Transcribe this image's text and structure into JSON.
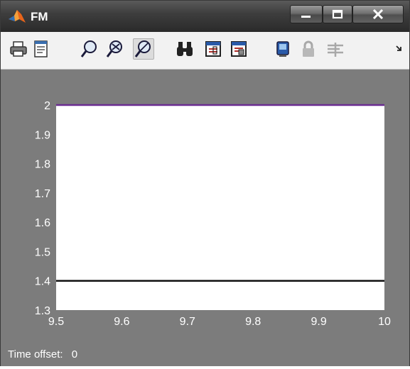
{
  "window": {
    "title": "FM",
    "buttons": [
      "minimize",
      "maximize",
      "close"
    ]
  },
  "toolbar": {
    "icons": [
      "print-icon",
      "print-preview-icon",
      "zoom-in-icon",
      "zoom-x-icon",
      "zoom-y-icon",
      "find-icon",
      "scope-parameters-icon",
      "save-axes-icon",
      "restore-axes-icon",
      "float-lock-icon",
      "signal-selection-icon",
      "overflow-chevron-icon"
    ]
  },
  "status": {
    "label": "Time offset:",
    "value": "0"
  },
  "chart_data": {
    "type": "line",
    "xlim": [
      9.5,
      10
    ],
    "ylim": [
      1.3,
      2
    ],
    "xticks": [
      "9.5",
      "9.6",
      "9.7",
      "9.8",
      "9.9",
      "10"
    ],
    "yticks": [
      "1.3",
      "1.4",
      "1.5",
      "1.6",
      "1.7",
      "1.8",
      "1.9",
      "2"
    ],
    "series": [
      {
        "x": [
          9.5,
          10
        ],
        "y": [
          2,
          2
        ],
        "color": "#6a2c91"
      },
      {
        "x": [
          9.5,
          10
        ],
        "y": [
          1.4,
          1.4
        ],
        "color": "#111111"
      }
    ],
    "grid": false,
    "background": "#ffffff",
    "frame_color": "#7c7c7c"
  }
}
